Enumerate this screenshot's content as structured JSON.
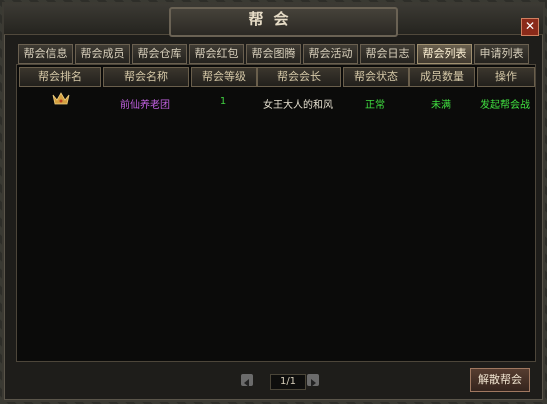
{
  "window": {
    "title": "帮会",
    "close_glyph": "✕"
  },
  "tabs": [
    {
      "label": "帮会信息",
      "active": false
    },
    {
      "label": "帮会成员",
      "active": false
    },
    {
      "label": "帮会仓库",
      "active": false
    },
    {
      "label": "帮会红包",
      "active": false
    },
    {
      "label": "帮会图腾",
      "active": false
    },
    {
      "label": "帮会活动",
      "active": false
    },
    {
      "label": "帮会日志",
      "active": false
    },
    {
      "label": "帮会列表",
      "active": true
    },
    {
      "label": "申请列表",
      "active": false
    }
  ],
  "table": {
    "headers": [
      "帮会排名",
      "帮会名称",
      "帮会等级",
      "帮会会长",
      "帮会状态",
      "成员数量",
      "操作"
    ],
    "rows": [
      {
        "rank_icon": "crown-icon",
        "name": "前仙养老团",
        "level": "1",
        "leader": "女王大人的和风",
        "status": "正常",
        "members": "未满",
        "action": "发起帮会战"
      }
    ]
  },
  "pager": {
    "text": "1/1"
  },
  "buttons": {
    "disband": "解散帮会"
  },
  "colors": {
    "name": "#c060e0",
    "level": "#40d040",
    "leader": "#e6e0d0",
    "status": "#40e040",
    "members": "#40e040",
    "action": "#40e040"
  }
}
